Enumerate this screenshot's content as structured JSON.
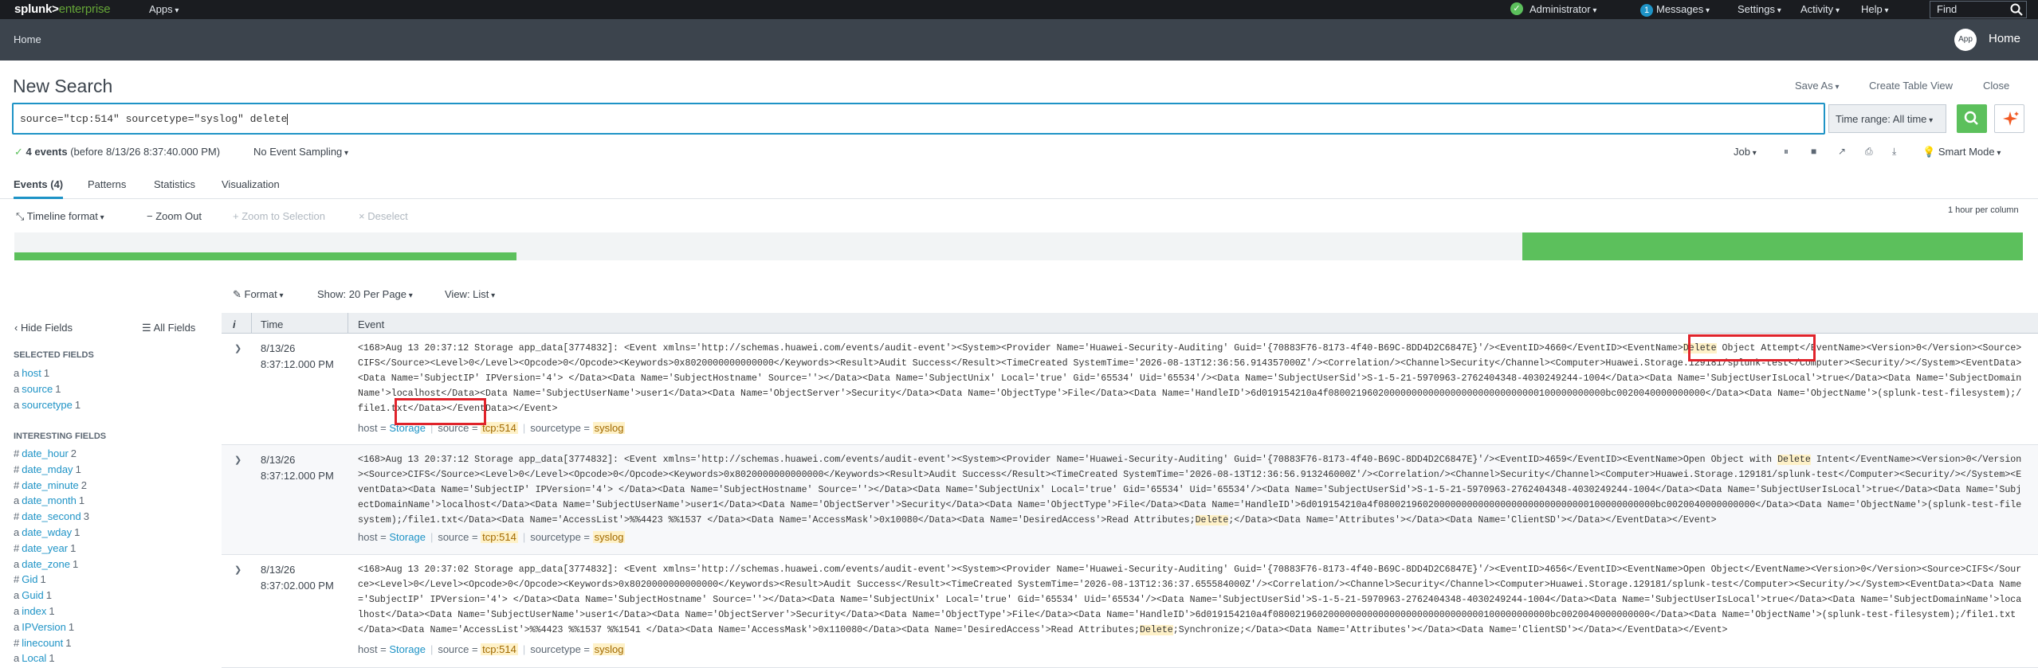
{
  "topbar": {
    "logo_main": "splunk>",
    "logo_product": "enterprise",
    "apps_label": "Apps",
    "user_label": "Administrator",
    "messages_count": "1",
    "messages_label": "Messages",
    "settings_label": "Settings",
    "activity_label": "Activity",
    "help_label": "Help",
    "find_label": "Find"
  },
  "appbar": {
    "home_label": "Home",
    "app_badge": "App",
    "app_home_label": "Home"
  },
  "page": {
    "title": "New Search",
    "save_as": "Save As",
    "create_table_view": "Create Table View",
    "close": "Close"
  },
  "search": {
    "query": "source=\"tcp:514\" sourcetype=\"syslog\" delete",
    "time_range": "Time range: All time"
  },
  "status": {
    "events_count": "4 events",
    "events_detail": "(before 8/13/26 8:37:40.000 PM)",
    "sampling": "No Event Sampling",
    "job_label": "Job",
    "smart_mode": "Smart Mode"
  },
  "tabs": [
    {
      "label": "Events (4)",
      "active": true
    },
    {
      "label": "Patterns",
      "active": false
    },
    {
      "label": "Statistics",
      "active": false
    },
    {
      "label": "Visualization",
      "active": false
    }
  ],
  "timeline": {
    "format_label": "Timeline format",
    "zoom_out": "Zoom Out",
    "zoom_selection": "Zoom to Selection",
    "deselect": "Deselect",
    "scale": "1 hour per column"
  },
  "results_controls": {
    "format": "Format",
    "show": "Show: 20 Per Page",
    "view": "View: List"
  },
  "fields": {
    "hide_fields": "Hide Fields",
    "all_fields": "All Fields",
    "selected_heading": "SELECTED FIELDS",
    "interesting_heading": "INTERESTING FIELDS",
    "selected": [
      {
        "type": "a",
        "name": "host",
        "count": "1"
      },
      {
        "type": "a",
        "name": "source",
        "count": "1"
      },
      {
        "type": "a",
        "name": "sourcetype",
        "count": "1"
      }
    ],
    "interesting": [
      {
        "type": "#",
        "name": "date_hour",
        "count": "2"
      },
      {
        "type": "#",
        "name": "date_mday",
        "count": "1"
      },
      {
        "type": "#",
        "name": "date_minute",
        "count": "2"
      },
      {
        "type": "a",
        "name": "date_month",
        "count": "1"
      },
      {
        "type": "#",
        "name": "date_second",
        "count": "3"
      },
      {
        "type": "a",
        "name": "date_wday",
        "count": "1"
      },
      {
        "type": "#",
        "name": "date_year",
        "count": "1"
      },
      {
        "type": "a",
        "name": "date_zone",
        "count": "1"
      },
      {
        "type": "#",
        "name": "Gid",
        "count": "1"
      },
      {
        "type": "a",
        "name": "Guid",
        "count": "1"
      },
      {
        "type": "a",
        "name": "index",
        "count": "1"
      },
      {
        "type": "a",
        "name": "IPVersion",
        "count": "1"
      },
      {
        "type": "#",
        "name": "linecount",
        "count": "1"
      },
      {
        "type": "a",
        "name": "Local",
        "count": "1"
      }
    ]
  },
  "table": {
    "col_info": "i",
    "col_time": "Time",
    "col_event": "Event"
  },
  "events": [
    {
      "date": "8/13/26",
      "time": "8:37:12.000 PM",
      "pre": "<168>Aug 13 20:37:12 Storage app_data[3774832]: <Event xmlns='http://schemas.huawei.com/events/audit-event'><System><Provider Name='Huawei-Security-Auditing' Guid='{70883F76-8173-4f40-B69C-8DD4D2C6847E}'/><EventID>4660</EventID><EventName>",
      "hl": "Delete",
      "post": " Object Attempt</EventName><Version>0</Version><Source>CIFS</Source><Level>0</Level><Opcode>0</Opcode><Keywords>0x8020000000000000</Keywords><Result>Audit Success</Result><TimeCreated SystemTime='2026-08-13T12:36:56.914357000Z'/><Correlation/><Channel>Security</Channel><Computer>Huawei.Storage.129181/splunk-test</Computer><Security/></System><EventData><Data Name='SubjectIP' IPVersion='4'>          </Data><Data Name='SubjectHostname' Source=''></Data><Data Name='SubjectUnix' Local='true' Gid='65534' Uid='65534'/><Data Name='SubjectUserSid'>S-1-5-21-5970963-2762404348-4030249244-1004</Data><Data Name='SubjectUserIsLocal'>true</Data><Data Name='SubjectDomainName'>localhost</Data><Data Name='SubjectUserName'>user1</Data><Data Name='ObjectServer'>Security</Data><Data Name='ObjectType'>File</Data><Data Name='HandleID'>6d019154210a4f08002196020000000000000000000000000000100000000000bc0020040000000000</Data><Data Name='ObjectName'>(splunk-test-filesystem);/file1.txt</Data></EventData></Event>",
      "host": "Storage",
      "source": "tcp:514",
      "sourcetype": "syslog"
    },
    {
      "date": "8/13/26",
      "time": "8:37:12.000 PM",
      "pre": "<168>Aug 13 20:37:12 Storage app_data[3774832]: <Event xmlns='http://schemas.huawei.com/events/audit-event'><System><Provider Name='Huawei-Security-Auditing' Guid='{70883F76-8173-4f40-B69C-8DD4D2C6847E}'/><EventID>4659</EventID><EventName>Open Object with ",
      "hl": "Delete",
      "post": " Intent</EventName><Version>0</Version><Source>CIFS</Source><Level>0</Level><Opcode>0</Opcode><Keywords>0x8020000000000000</Keywords><Result>Audit Success</Result><TimeCreated SystemTime='2026-08-13T12:36:56.913246000Z'/><Correlation/><Channel>Security</Channel><Computer>Huawei.Storage.129181/splunk-test</Computer><Security/></System><EventData><Data Name='SubjectIP' IPVersion='4'>          </Data><Data Name='SubjectHostname' Source=''></Data><Data Name='SubjectUnix' Local='true' Gid='65534' Uid='65534'/><Data Name='SubjectUserSid'>S-1-5-21-5970963-2762404348-4030249244-1004</Data><Data Name='SubjectUserIsLocal'>true</Data><Data Name='SubjectDomainName'>localhost</Data><Data Name='SubjectUserName'>user1</Data><Data Name='ObjectServer'>Security</Data><Data Name='ObjectType'>File</Data><Data Name='HandleID'>6d019154210a4f08002196020000000000000000000000000000100000000000bc0020040000000000</Data><Data Name='ObjectName'>(splunk-test-filesystem);/file1.txt</Data><Data Name='AccessList'>%%4423 %%1537 </Data><Data Name='AccessMask'>0x10080</Data><Data Name='DesiredAccess'>Read Attributes;",
      "hl2": "Delete",
      "post2": ";</Data><Data Name='Attributes'></Data><Data Name='ClientSD'></Data></EventData></Event>",
      "host": "Storage",
      "source": "tcp:514",
      "sourcetype": "syslog"
    },
    {
      "date": "8/13/26",
      "time": "8:37:02.000 PM",
      "pre": "<168>Aug 13 20:37:02 Storage app_data[3774832]: <Event xmlns='http://schemas.huawei.com/events/audit-event'><System><Provider Name='Huawei-Security-Auditing' Guid='{70883F76-8173-4f40-B69C-8DD4D2C6847E}'/><EventID>4656</EventID><EventName>Open Object</EventName><Version>0</Version><Source>CIFS</Source><Level>0</Level><Opcode>0</Opcode><Keywords>0x8020000000000000</Keywords><Result>Audit Success</Result><TimeCreated SystemTime='2026-08-13T12:36:37.655584000Z'/><Correlation/><Channel>Security</Channel><Computer>Huawei.Storage.129181/splunk-test</Computer><Security/></System><EventData><Data Name='SubjectIP' IPVersion='4'>          </Data><Data Name='SubjectHostname' Source=''></Data><Data Name='SubjectUnix' Local='true' Gid='65534' Uid='65534'/><Data Name='SubjectUserSid'>S-1-5-21-5970963-2762404348-4030249244-1004</Data><Data Name='SubjectUserIsLocal'>true</Data><Data Name='SubjectDomainName'>localhost</Data><Data Name='SubjectUserName'>user1</Data><Data Name='ObjectServer'>Security</Data><Data Name='ObjectType'>File</Data><Data Name='HandleID'>6d019154210a4f08002196020000000000000000000000000000100000000000bc0020040000000000</Data><Data Name='ObjectName'>(splunk-test-filesystem);/file1.txt</Data><Data Name='AccessList'>%%4423 %%1537 %%1541 </Data><Data Name='AccessMask'>0x110080</Data><Data Name='DesiredAccess'>Read Attributes;",
      "hl": "Delete",
      "post": ";Synchronize;</Data><Data Name='Attributes'></Data><Data Name='ClientSD'></Data></EventData></Event>",
      "host": "Storage",
      "source": "tcp:514",
      "sourcetype": "syslog"
    }
  ],
  "meta_labels": {
    "host": "host =",
    "source": "source =",
    "sourcetype": "sourcetype ="
  },
  "colors": {
    "accent": "#1e93c6",
    "success": "#5cc05c",
    "highlight_box": "#e0232b",
    "topbar": "#1a1c20",
    "appbar": "#3c444d"
  }
}
